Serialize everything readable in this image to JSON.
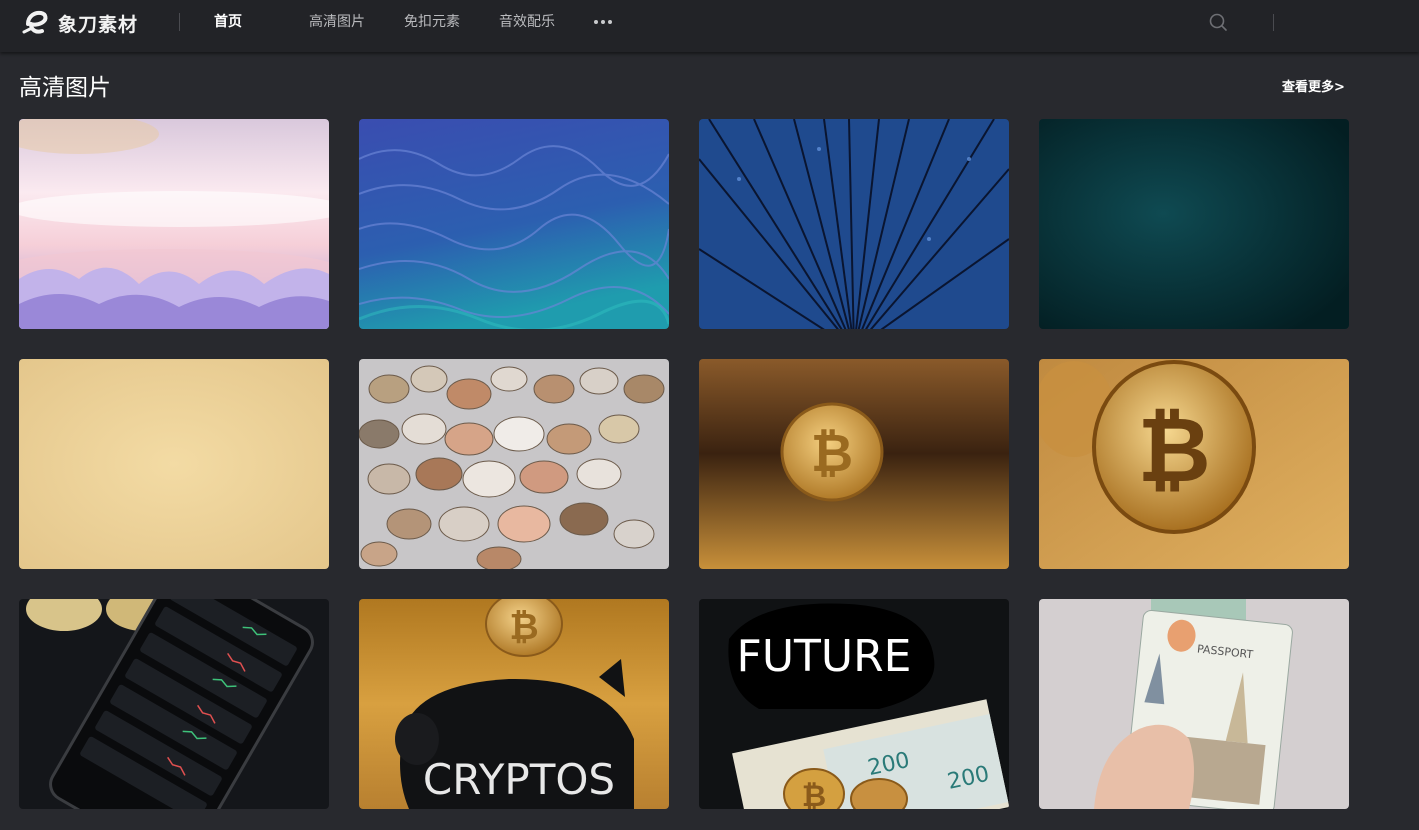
{
  "header": {
    "logo_text": "象刀素材",
    "nav": [
      {
        "label": "首页",
        "active": true
      },
      {
        "label": "高清图片",
        "active": false
      },
      {
        "label": "免扣元素",
        "active": false
      },
      {
        "label": "音效配乐",
        "active": false
      }
    ],
    "more_icon": "more-dots-icon",
    "search_icon": "search-icon"
  },
  "section": {
    "title": "高清图片",
    "see_more": "查看更多>"
  },
  "images": [
    {
      "subject": "pastel-clouds-sky"
    },
    {
      "subject": "blue-wavy-topographic-pattern"
    },
    {
      "subject": "blue-radial-speed-lines"
    },
    {
      "subject": "dark-teal-texture"
    },
    {
      "subject": "beige-paper-texture"
    },
    {
      "subject": "pile-of-coins"
    },
    {
      "subject": "bitcoin-on-gold-glitter"
    },
    {
      "subject": "bitcoin-closeup-gold-glitter"
    },
    {
      "subject": "crypto-trading-phone"
    },
    {
      "subject": "crypto-piggy-bank-with-bitcoin"
    },
    {
      "subject": "future-piggy-bank-banknotes"
    },
    {
      "subject": "passport-with-cash"
    }
  ],
  "image_texts": {
    "future": "FUTURE",
    "crypto": "CRYPTOS",
    "passport": "PASSPORT"
  },
  "colors": {
    "background": "#28292e",
    "header": "#222327"
  }
}
